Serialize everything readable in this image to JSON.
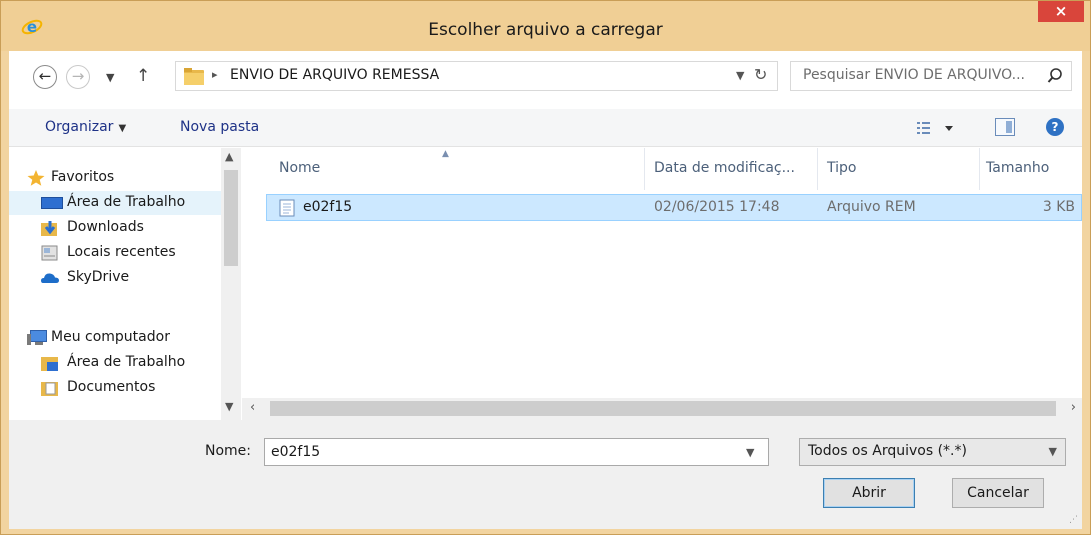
{
  "window": {
    "title": "Escolher arquivo a carregar",
    "close_glyph": "×"
  },
  "address": {
    "path": "ENVIO DE ARQUIVO REMESSA",
    "search_placeholder": "Pesquisar ENVIO DE ARQUIVO..."
  },
  "toolbar": {
    "organize": "Organizar",
    "new_folder": "Nova pasta",
    "help": "?"
  },
  "nav": {
    "items": [
      {
        "label": "Favoritos",
        "icon": "star-icon"
      },
      {
        "label": "Área de Trabalho",
        "icon": "desktop-icon"
      },
      {
        "label": "Downloads",
        "icon": "downloads-icon"
      },
      {
        "label": "Locais recentes",
        "icon": "recent-places-icon"
      },
      {
        "label": "SkyDrive",
        "icon": "cloud-icon"
      },
      {
        "label": "Meu computador",
        "icon": "computer-icon"
      },
      {
        "label": "Área de Trabalho",
        "icon": "desktop-folder-icon"
      },
      {
        "label": "Documentos",
        "icon": "documents-icon"
      }
    ]
  },
  "list": {
    "columns": [
      "Nome",
      "Data de modificaç...",
      "Tipo",
      "Tamanho"
    ],
    "rows": [
      {
        "name": "e02f15",
        "date": "02/06/2015 17:48",
        "type": "Arquivo REM",
        "size": "3 KB"
      }
    ]
  },
  "bottom": {
    "name_label": "Nome:",
    "file_name": "e02f15",
    "file_type": "Todos os Arquivos (*.*)",
    "open": "Abrir",
    "cancel": "Cancelar"
  },
  "colors": {
    "title_bar": "#f0cf95",
    "close_button": "#d9453b",
    "selection": "#cce8ff",
    "link_text": "#1e3287"
  }
}
